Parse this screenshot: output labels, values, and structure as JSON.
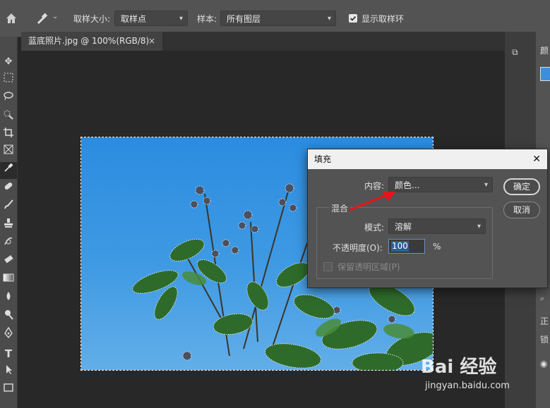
{
  "options_bar": {
    "sample_size_label": "取样大小:",
    "sample_size_value": "取样点",
    "sample_label": "样本:",
    "sample_value": "所有图层",
    "show_ring_label": "显示取样环",
    "show_ring_checked": true
  },
  "document": {
    "tab_label": "蓝底照片.jpg @ 100%(RGB/8)",
    "close_glyph": "×"
  },
  "right_panel": {
    "header_partial": "颜",
    "row1": "正",
    "row2": "锁"
  },
  "fill_dialog": {
    "title": "填充",
    "close_glyph": "✕",
    "content_label": "内容:",
    "content_value": "颜色...",
    "blend_group_label": "混合",
    "mode_label": "模式:",
    "mode_value": "溶解",
    "opacity_label": "不透明度(O):",
    "opacity_value": "100",
    "opacity_unit": "%",
    "preserve_transparency_label": "保留透明区域(P)",
    "ok_button": "确定",
    "cancel_button": "取消"
  },
  "watermark": {
    "brand": "Bai 经验",
    "url": "jingyan.baidu.com"
  },
  "colors": {
    "options_bar_bg": "#535353",
    "workspace_bg": "#282828",
    "canvas_sky": "#2b8ce0",
    "dialog_bg": "#535353",
    "opacity_input_bg": "#2f5e95",
    "annotation_arrow": "#e8141a"
  }
}
